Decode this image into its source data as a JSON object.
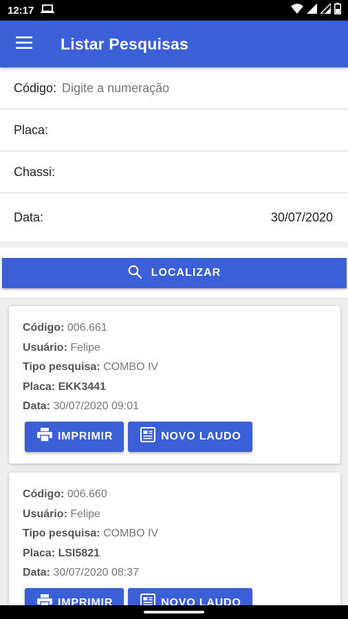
{
  "status_bar": {
    "time": "12:17"
  },
  "app_bar": {
    "title": "Listar Pesquisas"
  },
  "form": {
    "codigo": {
      "label": "Código:",
      "placeholder": "Digite a numeração"
    },
    "placa": {
      "label": "Placa:"
    },
    "chassi": {
      "label": "Chassi:"
    },
    "data": {
      "label": "Data:",
      "value": "30/07/2020"
    }
  },
  "search_button": {
    "label": "LOCALIZAR"
  },
  "results": [
    {
      "codigo_label": "Código:",
      "codigo": "006.661",
      "usuario_label": "Usuário:",
      "usuario": "Felipe",
      "tipo_label": "Tipo pesquisa:",
      "tipo": "COMBO IV",
      "placa_label": "Placa:",
      "placa": "EKK3441",
      "data_label": "Data:",
      "data": "30/07/2020 09:01",
      "print_label": "IMPRIMIR",
      "new_report_label": "NOVO LAUDO"
    },
    {
      "codigo_label": "Código:",
      "codigo": "006.660",
      "usuario_label": "Usuário:",
      "usuario": "Felipe",
      "tipo_label": "Tipo pesquisa:",
      "tipo": "COMBO IV",
      "placa_label": "Placa:",
      "placa": "LSI5821",
      "data_label": "Data:",
      "data": "30/07/2020 08:37",
      "print_label": "IMPRIMIR",
      "new_report_label": "NOVO LAUDO"
    }
  ],
  "colors": {
    "primary": "#3b5fd6",
    "background": "#eeeeee"
  }
}
